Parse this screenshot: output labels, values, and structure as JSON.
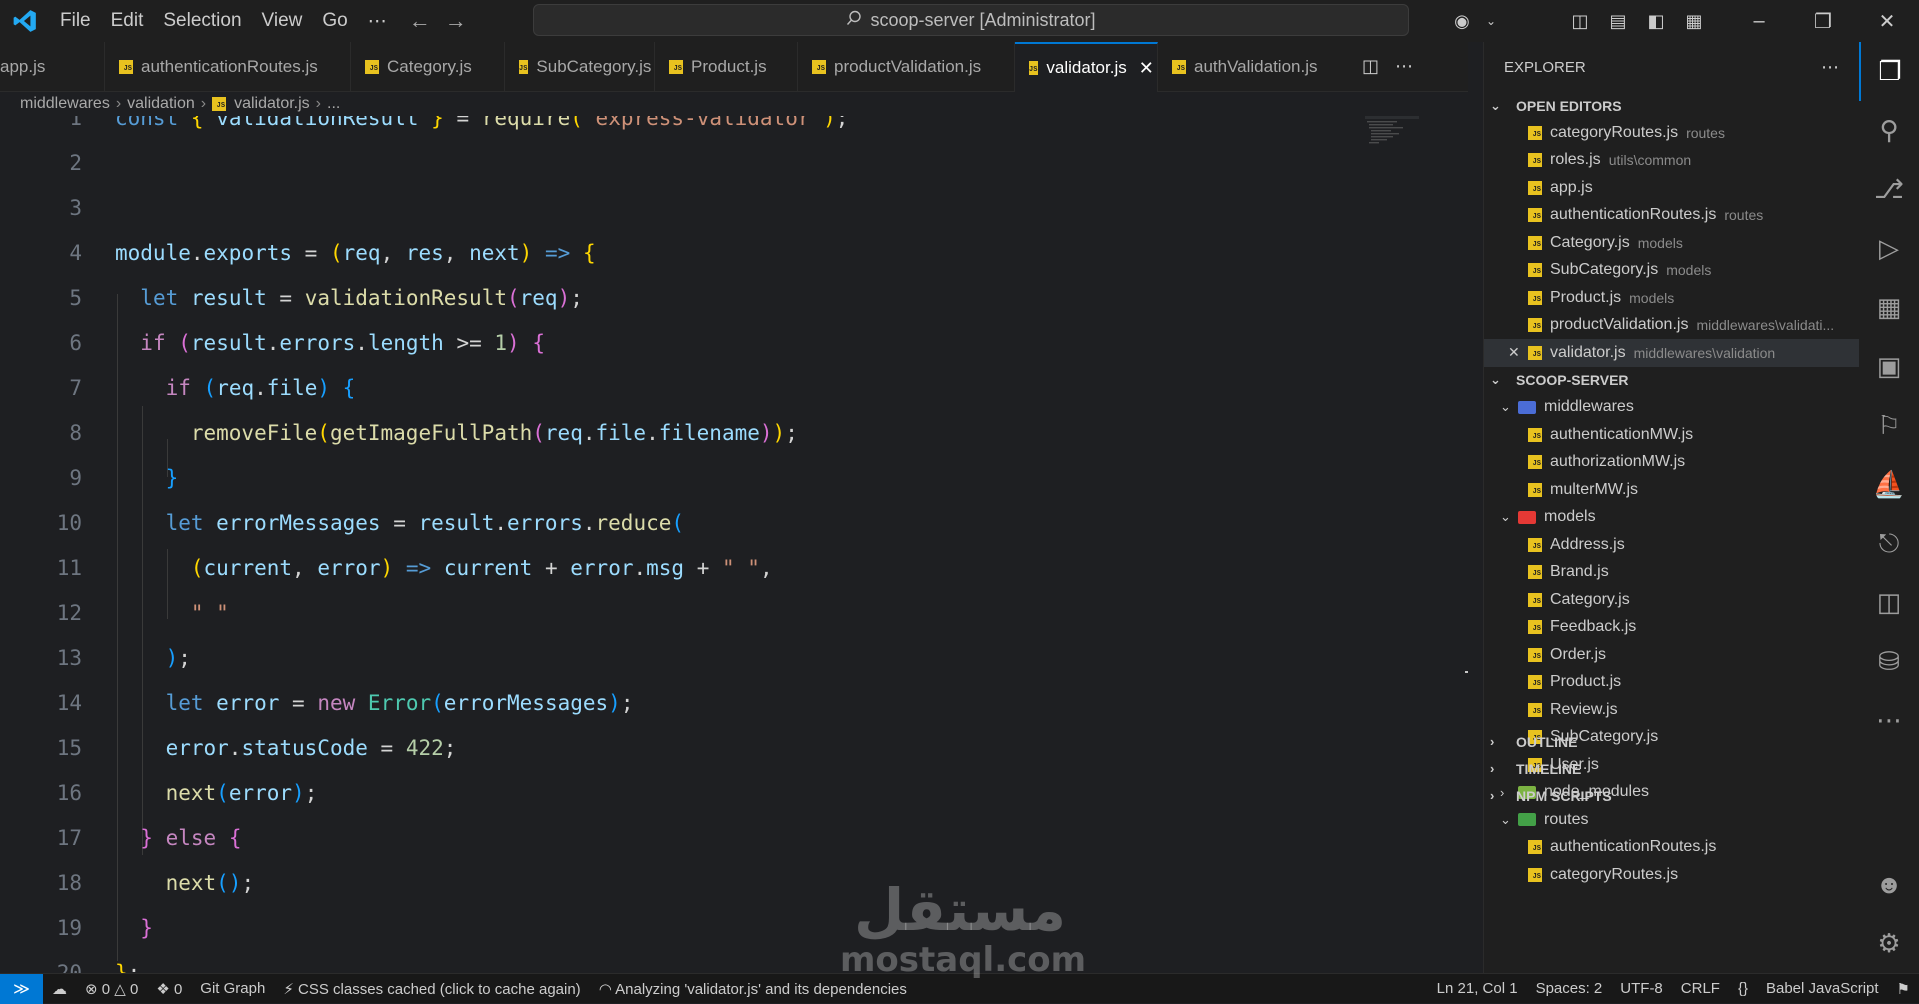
{
  "menu": [
    "File",
    "Edit",
    "Selection",
    "View",
    "Go",
    "⋯"
  ],
  "search": {
    "text": "scoop-server [Administrator]"
  },
  "tabs": [
    {
      "label": "app.js",
      "active": false
    },
    {
      "label": "authenticationRoutes.js",
      "active": false
    },
    {
      "label": "Category.js",
      "active": false
    },
    {
      "label": "SubCategory.js",
      "active": false
    },
    {
      "label": "Product.js",
      "active": false
    },
    {
      "label": "productValidation.js",
      "active": false
    },
    {
      "label": "validator.js",
      "active": true
    },
    {
      "label": "authValidation.js",
      "active": false
    }
  ],
  "breadcrumb": [
    "middlewares",
    "validation",
    "validator.js",
    "..."
  ],
  "code": {
    "lines": [
      {
        "n": "1",
        "text": "const { validationResult } = require(\"express-validator\");"
      },
      {
        "n": "2",
        "text": ""
      },
      {
        "n": "3",
        "text": ""
      },
      {
        "n": "4",
        "text": "module.exports = (req, res, next) => {"
      },
      {
        "n": "5",
        "text": "  let result = validationResult(req);"
      },
      {
        "n": "6",
        "text": "  if (result.errors.length >= 1) {"
      },
      {
        "n": "7",
        "text": "    if (req.file) {"
      },
      {
        "n": "8",
        "text": "      removeFile(getImageFullPath(req.file.filename));"
      },
      {
        "n": "9",
        "text": "    }"
      },
      {
        "n": "10",
        "text": "    let errorMessages = result.errors.reduce("
      },
      {
        "n": "11",
        "text": "      (current, error) => current + error.msg + \" \","
      },
      {
        "n": "12",
        "text": "      \" \""
      },
      {
        "n": "13",
        "text": "    );"
      },
      {
        "n": "14",
        "text": "    let error = new Error(errorMessages);"
      },
      {
        "n": "15",
        "text": "    error.statusCode = 422;"
      },
      {
        "n": "16",
        "text": "    next(error);"
      },
      {
        "n": "17",
        "text": "  } else {"
      },
      {
        "n": "18",
        "text": "    next();"
      },
      {
        "n": "19",
        "text": "  }"
      },
      {
        "n": "20",
        "text": "};"
      }
    ]
  },
  "explorer": {
    "title": "EXPLORER",
    "open_editors_title": "OPEN EDITORS",
    "open_editors": [
      {
        "name": "categoryRoutes.js",
        "desc": "routes"
      },
      {
        "name": "roles.js",
        "desc": "utils\\common"
      },
      {
        "name": "app.js",
        "desc": ""
      },
      {
        "name": "authenticationRoutes.js",
        "desc": "routes"
      },
      {
        "name": "Category.js",
        "desc": "models"
      },
      {
        "name": "SubCategory.js",
        "desc": "models"
      },
      {
        "name": "Product.js",
        "desc": "models"
      },
      {
        "name": "productValidation.js",
        "desc": "middlewares\\validati..."
      },
      {
        "name": "validator.js",
        "desc": "middlewares\\validation"
      }
    ],
    "project_title": "SCOOP-SERVER",
    "tree": [
      {
        "type": "folder",
        "name": "middlewares",
        "open": true,
        "depth": 1,
        "color": "#4b6dd6"
      },
      {
        "type": "file",
        "name": "authenticationMW.js",
        "depth": 2
      },
      {
        "type": "file",
        "name": "authorizationMW.js",
        "depth": 2
      },
      {
        "type": "file",
        "name": "multerMW.js",
        "depth": 2
      },
      {
        "type": "folder",
        "name": "models",
        "open": true,
        "depth": 1,
        "color": "#e53935"
      },
      {
        "type": "file",
        "name": "Address.js",
        "depth": 2
      },
      {
        "type": "file",
        "name": "Brand.js",
        "depth": 2
      },
      {
        "type": "file",
        "name": "Category.js",
        "depth": 2
      },
      {
        "type": "file",
        "name": "Feedback.js",
        "depth": 2
      },
      {
        "type": "file",
        "name": "Order.js",
        "depth": 2
      },
      {
        "type": "file",
        "name": "Product.js",
        "depth": 2
      },
      {
        "type": "file",
        "name": "Review.js",
        "depth": 2
      },
      {
        "type": "file",
        "name": "SubCategory.js",
        "depth": 2
      },
      {
        "type": "file",
        "name": "User.js",
        "depth": 2
      },
      {
        "type": "folder",
        "name": "node_modules",
        "open": false,
        "depth": 1,
        "color": "#7cb342"
      },
      {
        "type": "folder",
        "name": "routes",
        "open": true,
        "depth": 1,
        "color": "#43a047"
      },
      {
        "type": "file",
        "name": "authenticationRoutes.js",
        "depth": 2
      },
      {
        "type": "file",
        "name": "categoryRoutes.js",
        "depth": 2
      }
    ],
    "outline": "OUTLINE",
    "timeline": "TIMELINE",
    "npm_scripts": "NPM SCRIPTS"
  },
  "status": {
    "errors": "0",
    "warnings": "0",
    "ports": "0",
    "git_graph": "Git Graph",
    "css_cache": "CSS classes cached (click to cache again)",
    "analyzing": "Analyzing 'validator.js' and its dependencies",
    "position": "Ln 21, Col 1",
    "spaces": "Spaces: 2",
    "encoding": "UTF-8",
    "eol": "CRLF",
    "language": "Babel JavaScript"
  },
  "watermark": {
    "arabic": "مستقل",
    "latin": "mostaql.com"
  },
  "colors": {
    "accent": "#0078d4",
    "js_badge": "#e8c21f"
  }
}
